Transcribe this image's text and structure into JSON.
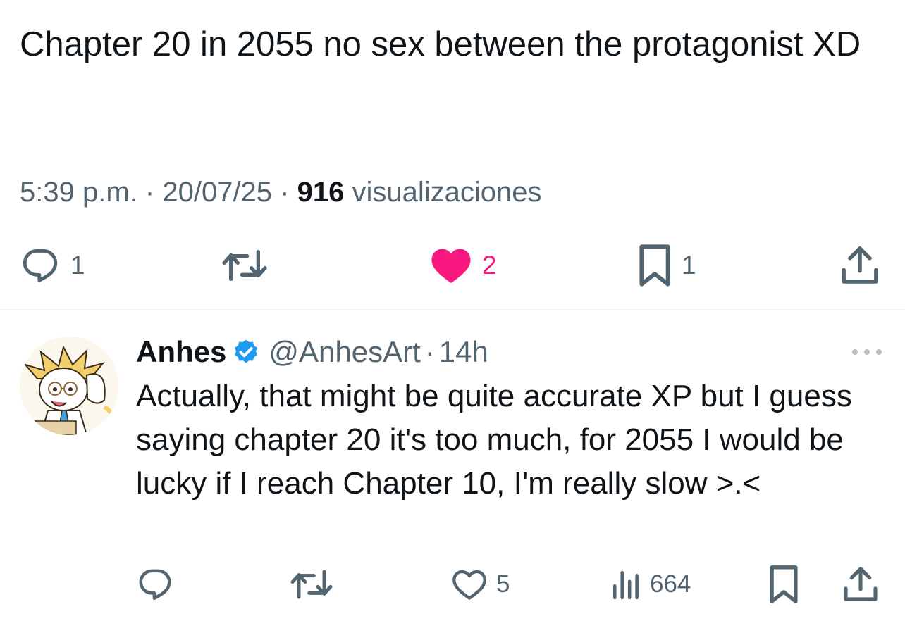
{
  "tweet": {
    "text": "Chapter 20 in 2055 no sex between the protagonist XD",
    "time": "5:39 p.m.",
    "separator": "·",
    "date": "20/07/25",
    "views_count": "916",
    "views_label": "visualizaciones",
    "actions": {
      "replies": "1",
      "likes": "2",
      "bookmarks": "1"
    },
    "like_color": "#f91880"
  },
  "reply": {
    "name": "Anhes",
    "handle": "@AnhesArt",
    "separator": "·",
    "time": "14h",
    "text": "Actually, that might be quite accurate XP but I guess saying chapter 20 it's too much, for 2055 I would be lucky if I reach Chapter 10, I'm really slow >.<",
    "actions": {
      "likes": "5",
      "views": "664"
    },
    "verified_color": "#1d9bf0"
  },
  "colors": {
    "text": "#0f1419",
    "secondary": "#536471",
    "divider": "#eff3f4"
  }
}
